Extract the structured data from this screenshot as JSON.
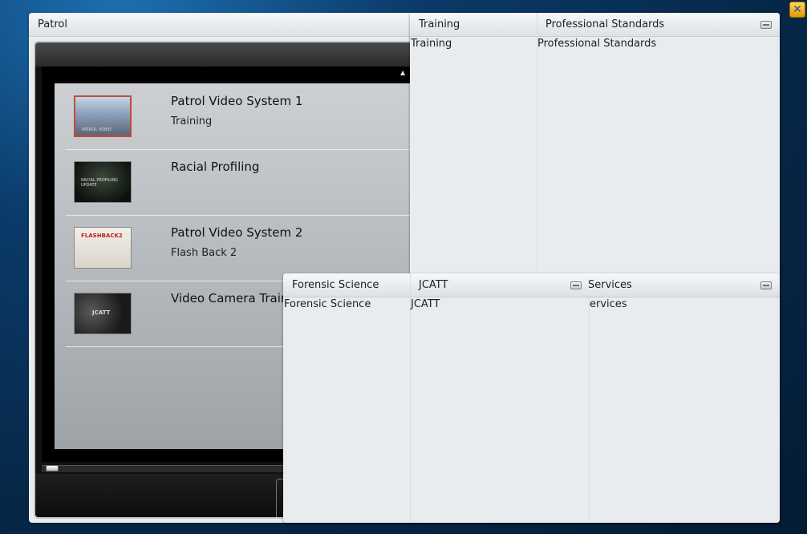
{
  "patrol_window": {
    "title": "Patrol"
  },
  "video_list": {
    "scroll_up_glyph": "▲",
    "items": [
      {
        "title": "Patrol Video System 1",
        "subtitle": "Training",
        "thumb_text": "PATROL VIDEO"
      },
      {
        "title": "Racial Profiling",
        "subtitle": "",
        "thumb_text": "RACIAL PROFILING UPDATE"
      },
      {
        "title": "Patrol Video System 2",
        "subtitle": "Flash Back 2",
        "thumb_text": "FLASHBACK2"
      },
      {
        "title": "Video Camera Train",
        "subtitle": "",
        "thumb_text": "JCATT"
      }
    ]
  },
  "top_window": {
    "columns": [
      {
        "header": "Training",
        "item": "Training"
      },
      {
        "header": "Professional Standards",
        "item": "Professional Standards"
      }
    ]
  },
  "bottom_window": {
    "columns": [
      {
        "header": "Forensic Science",
        "item": "Forensic Science"
      },
      {
        "header": "JCATT",
        "item": "JCATT"
      },
      {
        "header": "Services",
        "item": "ervices"
      }
    ]
  },
  "icons": {
    "close": "close-icon",
    "minimize": "minimize-icon",
    "close_glyph": "✕"
  },
  "colors": {
    "accent_close": "#f0b21f",
    "panel_bg": "#e9ecef",
    "desktop_bg": "#0b3b6a"
  }
}
